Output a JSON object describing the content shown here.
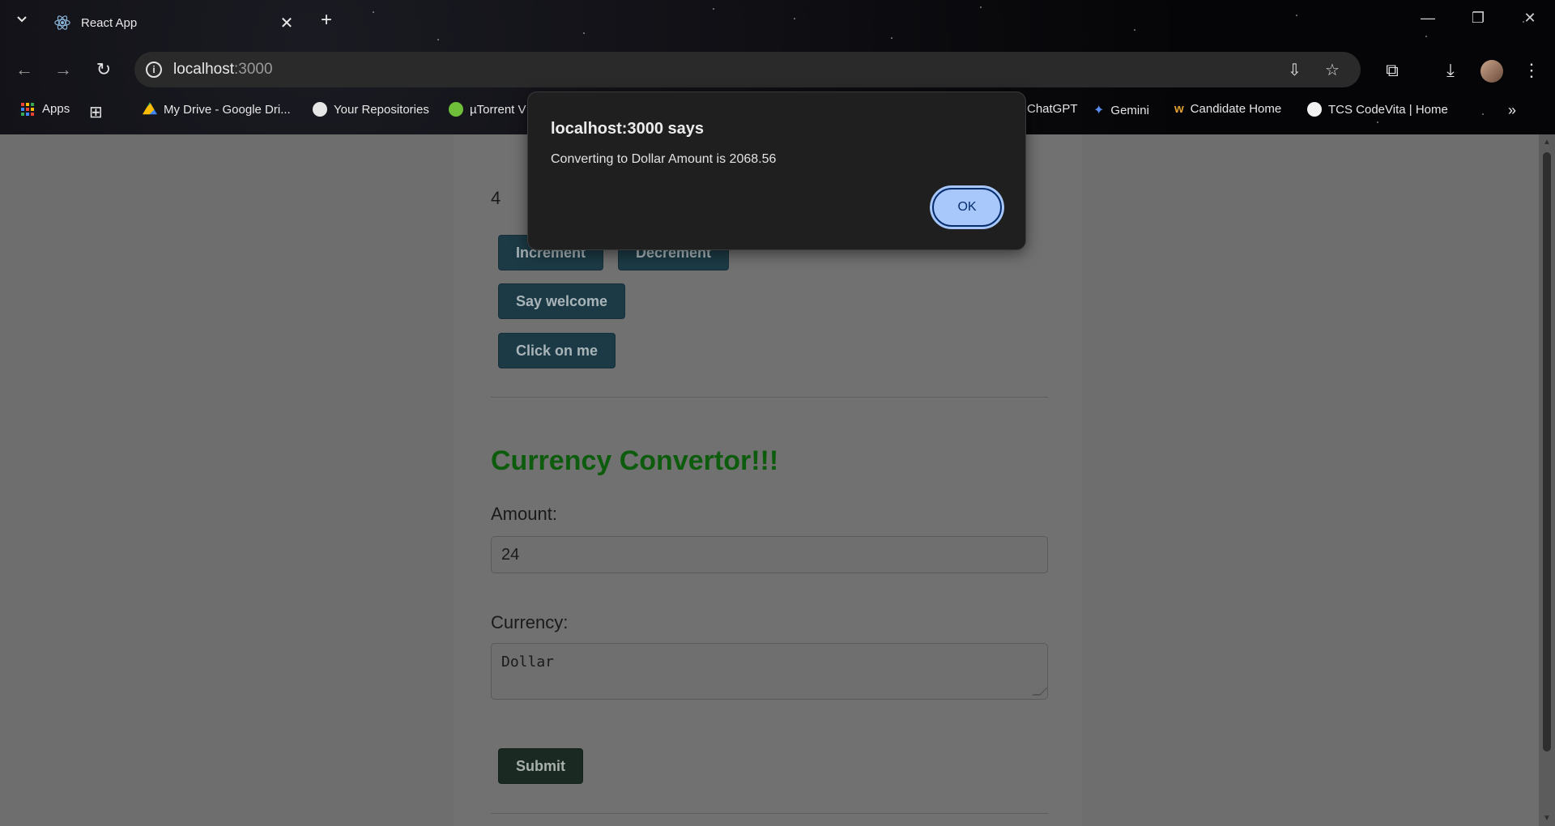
{
  "browser": {
    "tab_title": "React App",
    "url_host": "localhost",
    "url_port": ":3000",
    "bookmarks": [
      {
        "label": "Apps"
      },
      {
        "label": ""
      },
      {
        "label": "My Drive - Google Dri..."
      },
      {
        "label": "Your Repositories"
      },
      {
        "label": "µTorrent V"
      },
      {
        "label": "ChatGPT"
      },
      {
        "label": "Gemini"
      },
      {
        "label": "Candidate Home"
      },
      {
        "label": "TCS CodeVita | Home"
      }
    ]
  },
  "page": {
    "counter": "4",
    "increment_label": "Increment",
    "decrement_label": "Decrement",
    "welcome_label": "Say welcome",
    "click_label": "Click on me",
    "converter_title": "Currency Convertor!!!",
    "amount_label": "Amount:",
    "amount_value": "24",
    "currency_label": "Currency:",
    "currency_value": "Dollar",
    "submit_label": "Submit"
  },
  "dialog": {
    "title": "localhost:3000 says",
    "message": "Converting to Dollar Amount is 2068.56",
    "ok_label": "OK"
  },
  "colors": {
    "dialog_ok": "#a8c7fa",
    "title_green": "#0d5c0d",
    "button_bg": "#1c3a45"
  }
}
